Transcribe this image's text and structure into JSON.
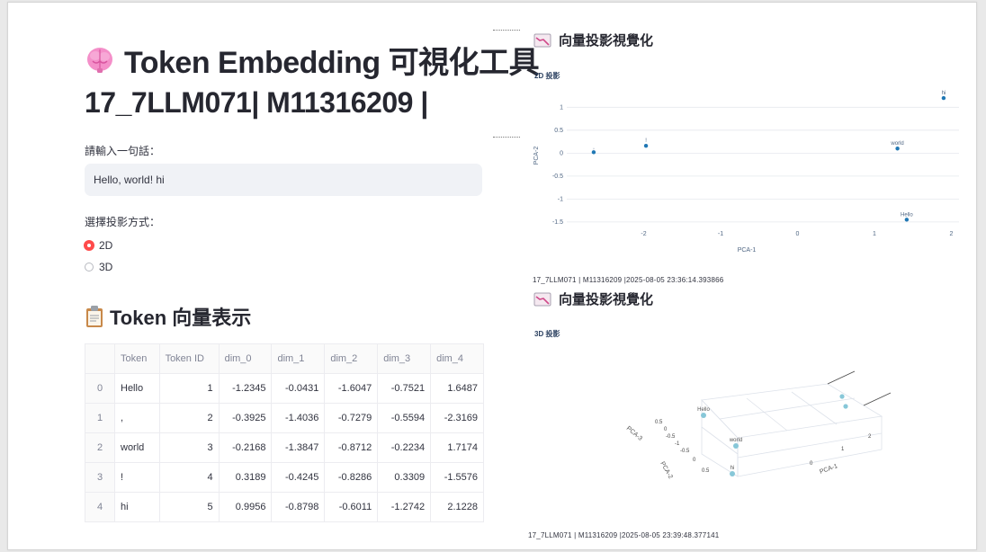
{
  "app": {
    "title": "Token Embedding 可視化工具",
    "subtitle": "17_7LLM071| M11316209 |",
    "title_icon": "brain-icon"
  },
  "input": {
    "label": "請輸入一句話：",
    "value": "Hello, world! hi"
  },
  "projection": {
    "label": "選擇投影方式：",
    "options": [
      "2D",
      "3D"
    ],
    "selected": "2D"
  },
  "table_section": {
    "title": "Token 向量表示",
    "icon": "clipboard-icon",
    "columns": [
      "",
      "Token",
      "Token ID",
      "dim_0",
      "dim_1",
      "dim_2",
      "dim_3",
      "dim_4"
    ],
    "rows": [
      [
        "0",
        "Hello",
        "1",
        "-1.2345",
        "-0.0431",
        "-1.6047",
        "-0.7521",
        "1.6487"
      ],
      [
        "1",
        ",",
        "2",
        "-0.3925",
        "-1.4036",
        "-0.7279",
        "-0.5594",
        "-2.3169"
      ],
      [
        "2",
        "world",
        "3",
        "-0.2168",
        "-1.3847",
        "-0.8712",
        "-0.2234",
        "1.7174"
      ],
      [
        "3",
        "!",
        "4",
        "0.3189",
        "-0.4245",
        "-0.8286",
        "0.3309",
        "-1.5576"
      ],
      [
        "4",
        "hi",
        "5",
        "0.9956",
        "-0.8798",
        "-0.6011",
        "-1.2742",
        "2.1228"
      ]
    ]
  },
  "viz1": {
    "header": "向量投影視覺化",
    "icon": "chart-icon",
    "caption": "17_7LLM071 | M11316209 |2025-08-05 23:36:14.393866"
  },
  "viz2": {
    "header": "向量投影視覺化",
    "icon": "chart-icon",
    "caption": "17_7LLM071 | M11316209 |2025-08-05 23:39:48.377141"
  },
  "chart_data": [
    {
      "type": "scatter",
      "title": "2D 投影",
      "xlabel": "PCA-1",
      "ylabel": "PCA-2",
      "xlim": [
        -3,
        2.1
      ],
      "ylim": [
        -1.6,
        1.3
      ],
      "xticks": [
        -2,
        -1,
        0,
        1,
        2
      ],
      "yticks": [
        -1.5,
        -1,
        -0.5,
        0,
        0.5,
        1
      ],
      "grid": true,
      "points": [
        {
          "label": ",",
          "x": -2.65,
          "y": 0.02
        },
        {
          "label": "!",
          "x": -1.97,
          "y": 0.16
        },
        {
          "label": "world",
          "x": 1.3,
          "y": 0.1
        },
        {
          "label": "Hello",
          "x": 1.42,
          "y": -1.45
        },
        {
          "label": "hi",
          "x": 1.9,
          "y": 1.2
        }
      ],
      "marker_color": "#1f77b4"
    },
    {
      "type": "scatter",
      "title": "3D 投影",
      "xlabel": "PCA-1",
      "ylabel": "PCA-2",
      "zlabel": "PCA-3",
      "labels": [
        "Hello",
        "world",
        "hi"
      ],
      "marker_color": "#87c7d8"
    }
  ]
}
